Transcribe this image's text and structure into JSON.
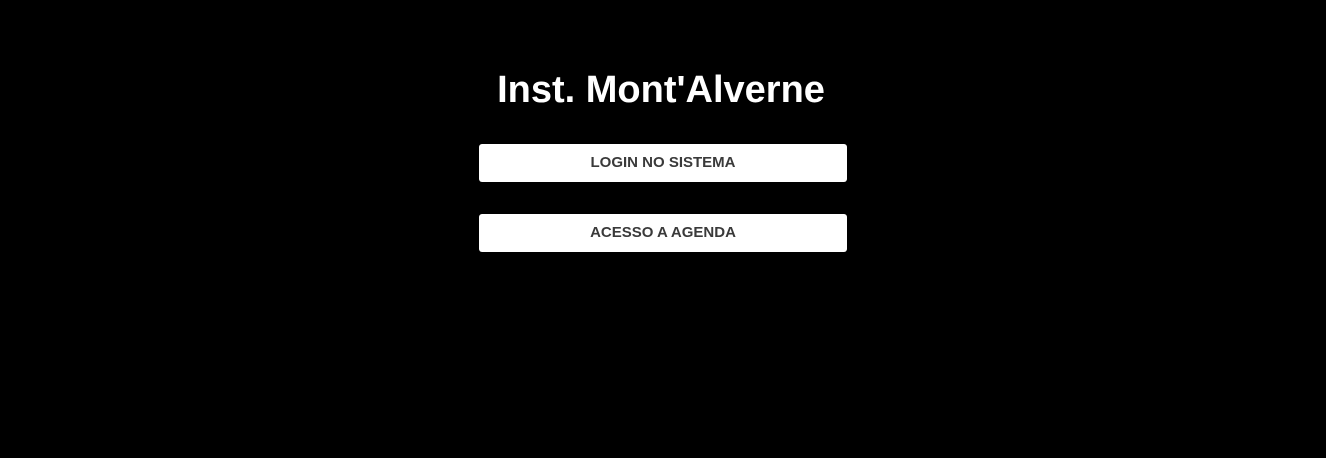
{
  "header": {
    "title": "Inst. Mont'Alverne"
  },
  "actions": {
    "login_label": "LOGIN NO SISTEMA",
    "agenda_label": "ACESSO A AGENDA"
  },
  "colors": {
    "background": "#000000",
    "title_text": "#ffffff",
    "button_background": "#ffffff",
    "button_text": "#3a3a3a"
  }
}
